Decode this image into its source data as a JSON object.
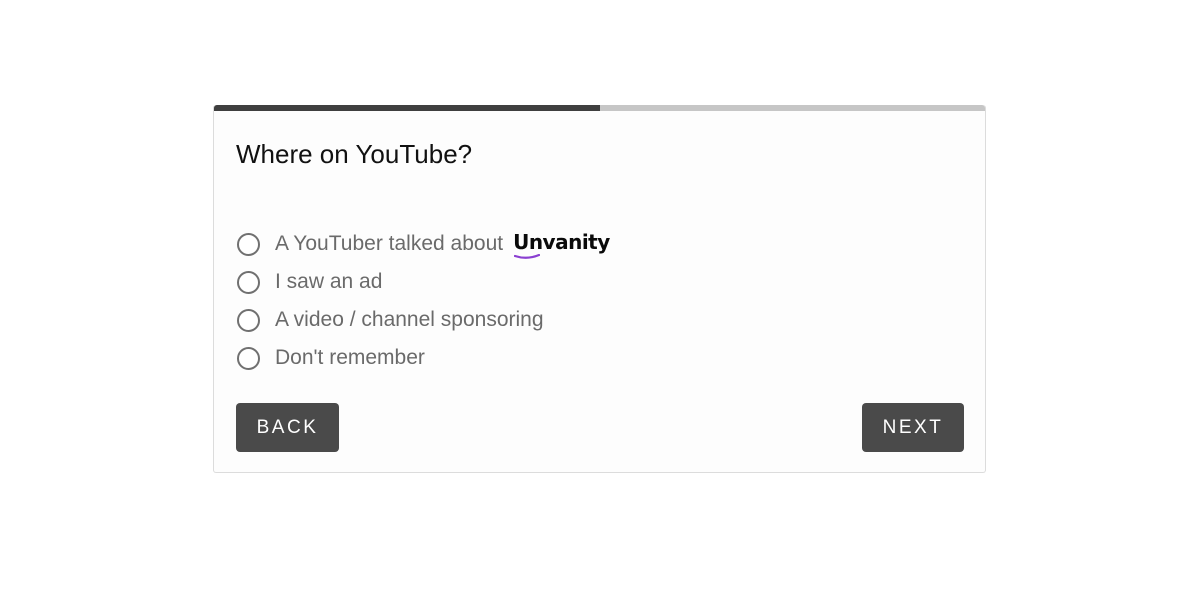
{
  "survey": {
    "progress": 0.5,
    "progress_color": "#3f3f3f",
    "progress_track_color": "#c6c6c6",
    "question": "Where on YouTube?",
    "options": [
      {
        "label": "A YouTuber talked about",
        "selected": false
      },
      {
        "label": "I saw an ad",
        "selected": false
      },
      {
        "label": "A video / channel sponsoring",
        "selected": false
      },
      {
        "label": "Don't remember",
        "selected": false
      }
    ],
    "brand_logo": {
      "text": "Unvanity",
      "accent_color": "#8a3fd1"
    },
    "back_label": "BACK",
    "next_label": "NEXT",
    "button_color": "#4a4a4a"
  }
}
